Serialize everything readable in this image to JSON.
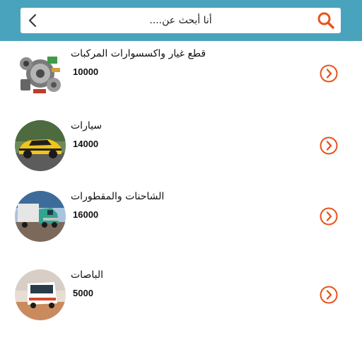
{
  "search": {
    "placeholder": "أنا أبحث عن....",
    "back_icon": "chevron-left-icon",
    "search_icon": "magnifier-icon",
    "accent_color": "#e8541c",
    "bar_color": "#4aa3bd"
  },
  "categories": [
    {
      "title": "قطع غيار واكسسوارات المركبات",
      "count": "10000",
      "icon": "car-parts-image"
    },
    {
      "title": "سيارات",
      "count": "14000",
      "icon": "yellow-car-image"
    },
    {
      "title": "الشاحنات والمقطورات",
      "count": "16000",
      "icon": "truck-image"
    },
    {
      "title": "الباصات",
      "count": "5000",
      "icon": "bus-image"
    }
  ]
}
